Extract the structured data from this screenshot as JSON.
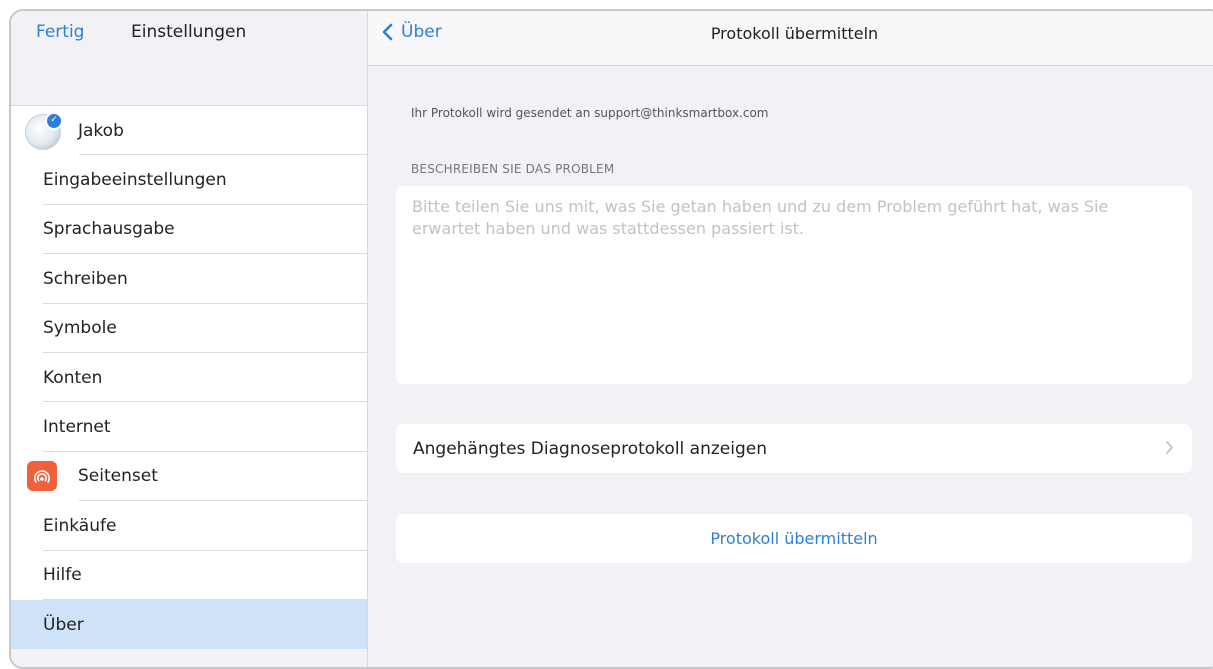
{
  "sidebar": {
    "done_label": "Fertig",
    "title": "Einstellungen",
    "items": [
      {
        "label": "Jakob",
        "icon": "avatar"
      },
      {
        "label": "Eingabeeinstellungen"
      },
      {
        "label": "Sprachausgabe"
      },
      {
        "label": "Schreiben"
      },
      {
        "label": "Symbole"
      },
      {
        "label": "Konten"
      },
      {
        "label": "Internet"
      },
      {
        "label": "Seitenset",
        "icon": "seitenset-icon"
      },
      {
        "label": "Einkäufe"
      },
      {
        "label": "Hilfe"
      },
      {
        "label": "Über",
        "selected": true
      }
    ]
  },
  "nav": {
    "back_label": "Über",
    "title": "Protokoll übermitteln"
  },
  "main": {
    "info_text": "Ihr Protokoll wird gesendet an support@thinksmartbox.com",
    "section_label": "BESCHREIBEN SIE DAS PROBLEM",
    "problem_placeholder": "Bitte teilen Sie uns mit, was Sie getan haben und zu dem Problem geführt hat, was Sie erwartet haben und was stattdessen passiert ist.",
    "problem_value": "",
    "diagnose_row_label": "Angehängtes Diagnoseprotokoll anzeigen",
    "submit_label": "Protokoll übermitteln"
  },
  "colors": {
    "accent": "#2f7fd6",
    "selected_row": "#cfe3f8",
    "seitenset_icon": "#f0603a",
    "background": "#f2f2f6"
  }
}
